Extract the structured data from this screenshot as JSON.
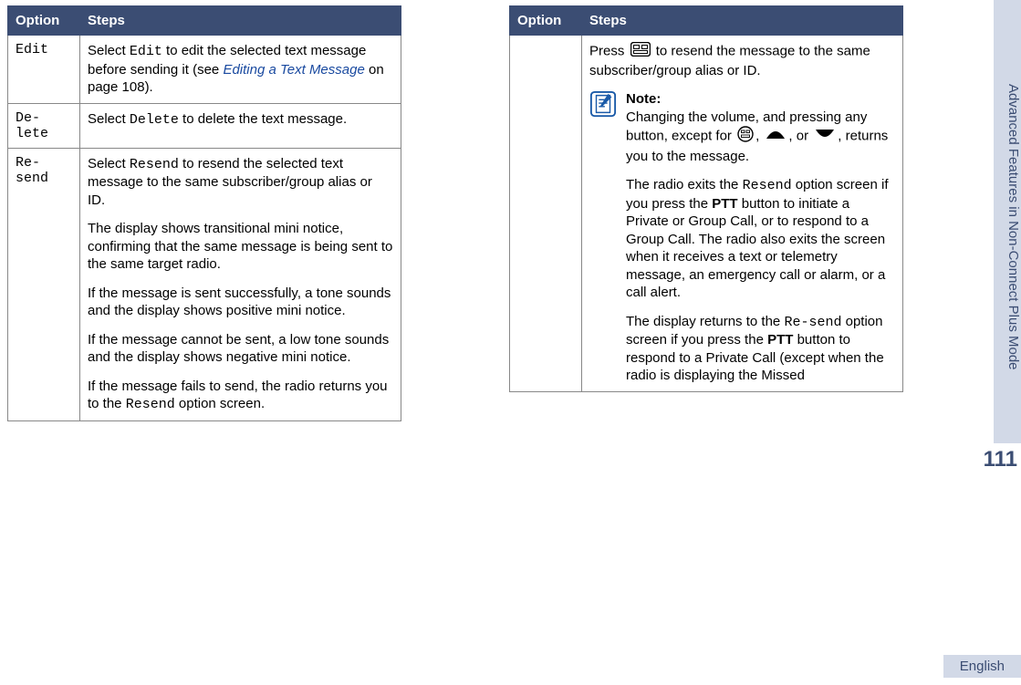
{
  "sideTab": "Advanced Features in Non-Connect Plus Mode",
  "pageNumber": "111",
  "language": "English",
  "headers": {
    "option": "Option",
    "steps": "Steps"
  },
  "left": {
    "rows": [
      {
        "opt": "Edit",
        "pre": "Select ",
        "code": "Edit",
        "mid": " to edit the selected text message before sending it (see ",
        "link": "Editing a Text Message",
        "post": " on page 108)."
      },
      {
        "opt": "De-lete",
        "pre": "Select ",
        "code": "Delete",
        "post": " to delete the text message."
      },
      {
        "opt": "Re-send",
        "p1_pre": "Select ",
        "p1_code": "Resend",
        "p1_post": " to resend the selected text message to the same subscriber/group alias or ID.",
        "p2": "The display shows transitional mini notice, confirming that the same message is being sent to the same target radio.",
        "p3": "If the message is sent successfully, a tone sounds and the display shows positive mini notice.",
        "p4": "If the message cannot be sent, a low tone sounds and the display shows negative mini notice.",
        "p5_pre": "If the message fails to send, the radio returns you to the ",
        "p5_code": "Resend",
        "p5_post": " option screen."
      }
    ]
  },
  "right": {
    "press_pre": "Press ",
    "press_post": " to resend the message to the same subscriber/group alias or ID.",
    "note_label": "Note:",
    "note_p1_pre": "Changing the volume, and pressing any button, except for ",
    "note_p1_mid1": ", ",
    "note_p1_mid2": ", or ",
    "note_p1_post": ", returns you to the message.",
    "note_p2_pre": "The radio exits the ",
    "note_p2_code": "Resend",
    "note_p2_mid": " option screen if you press the ",
    "note_p2_b": "PTT",
    "note_p2_post": " button to initiate a Private or Group Call, or to respond to a Group Call. The radio also exits the screen when it receives a text or telemetry message, an emergency call or alarm, or a call alert.",
    "note_p3_pre": "The display returns to the ",
    "note_p3_code": "Re-send",
    "note_p3_mid": " option screen if you press the ",
    "note_p3_b": "PTT",
    "note_p3_post": " button to respond to a Private Call (except when the radio is displaying the Missed"
  }
}
